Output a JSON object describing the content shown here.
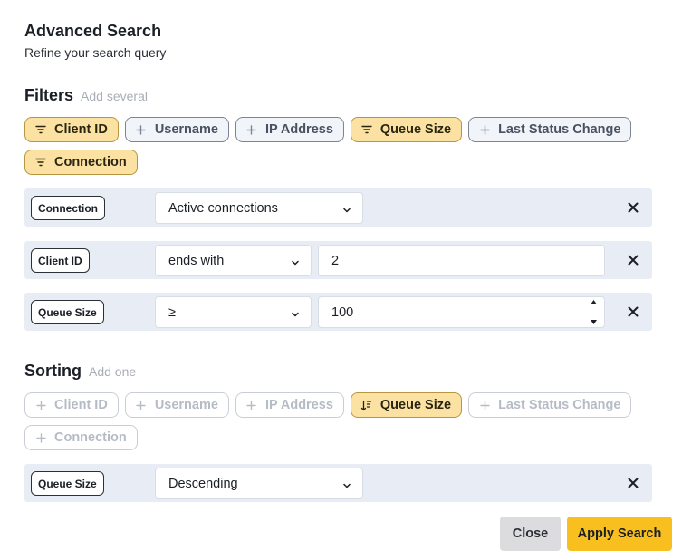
{
  "dialog": {
    "title": "Advanced Search",
    "subtitle": "Refine your search query"
  },
  "filters": {
    "heading": "Filters",
    "hint": "Add several",
    "chips": [
      {
        "label": "Client ID",
        "state": "active",
        "icon": "filter-icon"
      },
      {
        "label": "Username",
        "state": "default",
        "icon": "plus-icon"
      },
      {
        "label": "IP Address",
        "state": "default",
        "icon": "plus-icon"
      },
      {
        "label": "Queue Size",
        "state": "active",
        "icon": "filter-icon"
      },
      {
        "label": "Last Status Change",
        "state": "default",
        "icon": "plus-icon"
      },
      {
        "label": "Connection",
        "state": "active",
        "icon": "filter-icon"
      }
    ],
    "rules": [
      {
        "tag": "Connection",
        "operator": "Active connections"
      },
      {
        "tag": "Client ID",
        "operator": "ends with",
        "value": "2"
      },
      {
        "tag": "Queue Size",
        "operator": "≥",
        "value": "100"
      }
    ]
  },
  "sorting": {
    "heading": "Sorting",
    "hint": "Add one",
    "chips": [
      {
        "label": "Client ID",
        "state": "disabled",
        "icon": "plus-icon"
      },
      {
        "label": "Username",
        "state": "disabled",
        "icon": "plus-icon"
      },
      {
        "label": "IP Address",
        "state": "disabled",
        "icon": "plus-icon"
      },
      {
        "label": "Queue Size",
        "state": "active",
        "icon": "sort-descending-icon"
      },
      {
        "label": "Last Status Change",
        "state": "disabled",
        "icon": "plus-icon"
      },
      {
        "label": "Connection",
        "state": "disabled",
        "icon": "plus-icon"
      }
    ],
    "rules": [
      {
        "tag": "Queue Size",
        "direction": "Descending"
      }
    ]
  },
  "actions": {
    "close_label": "Close",
    "apply_label": "Apply Search"
  },
  "colors": {
    "accent": "#f8bf1e",
    "chip_active_bg": "#fbe2a2",
    "row_bg": "#e8edf5"
  }
}
